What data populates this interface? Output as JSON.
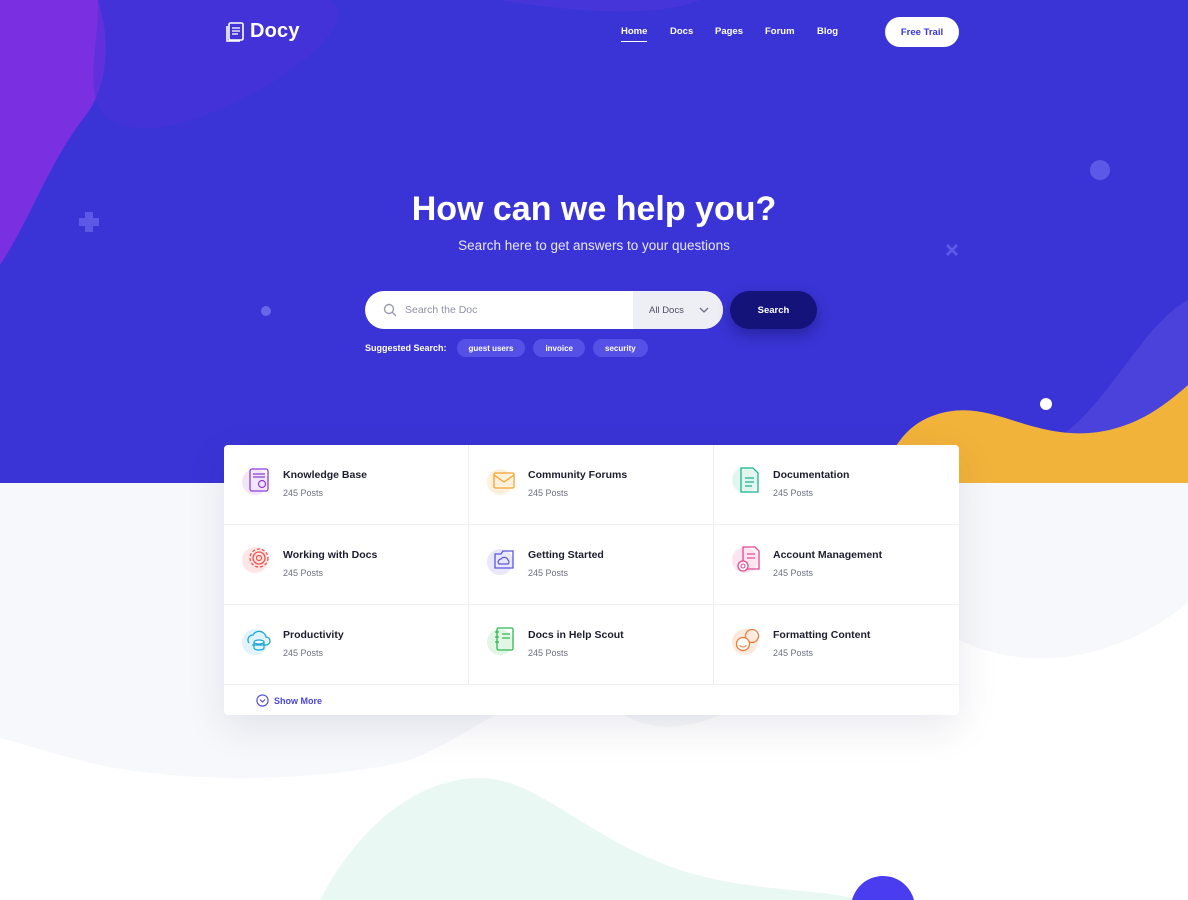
{
  "brand": {
    "name": "Docy",
    "logo_icon": "docs-stack-icon"
  },
  "nav": {
    "items": [
      {
        "label": "Home",
        "active": true
      },
      {
        "label": "Docs",
        "active": false
      },
      {
        "label": "Pages",
        "active": false
      },
      {
        "label": "Forum",
        "active": false
      },
      {
        "label": "Blog",
        "active": false
      }
    ],
    "cta_label": "Free Trail"
  },
  "hero": {
    "title": "How can we help you?",
    "subtitle": "Search here to get answers to your questions"
  },
  "search": {
    "placeholder": "Search the Doc",
    "value": "",
    "scope_selected": "All Docs",
    "button_label": "Search",
    "suggested_label": "Suggested Search:",
    "suggestions": [
      "guest users",
      "invoice",
      "security"
    ]
  },
  "categories": [
    {
      "title": "Knowledge Base",
      "posts": "245 Posts",
      "icon": "knowledge-base-icon",
      "color": "#8e3fd9"
    },
    {
      "title": "Community Forums",
      "posts": "245 Posts",
      "icon": "envelope-icon",
      "color": "#f2a328"
    },
    {
      "title": "Documentation",
      "posts": "245 Posts",
      "icon": "document-icon",
      "color": "#17b58d"
    },
    {
      "title": "Working with Docs",
      "posts": "245 Posts",
      "icon": "gear-icon",
      "color": "#f0544f"
    },
    {
      "title": "Getting Started",
      "posts": "245 Posts",
      "icon": "cloud-folder-icon",
      "color": "#5a55e0"
    },
    {
      "title": "Account Management",
      "posts": "245 Posts",
      "icon": "document-gear-icon",
      "color": "#e04891"
    },
    {
      "title": "Productivity",
      "posts": "245 Posts",
      "icon": "cloud-database-icon",
      "color": "#1aa6d8"
    },
    {
      "title": "Docs in Help Scout",
      "posts": "245 Posts",
      "icon": "notebook-icon",
      "color": "#2bb94f"
    },
    {
      "title": "Formatting Content",
      "posts": "245 Posts",
      "icon": "chat-bubbles-icon",
      "color": "#f07a3a"
    }
  ],
  "show_more_label": "Show More",
  "colors": {
    "hero": "#3a34d6",
    "accent": "#4a45d9",
    "search_button": "#14137a",
    "wave_yellow": "#f2b33a"
  }
}
